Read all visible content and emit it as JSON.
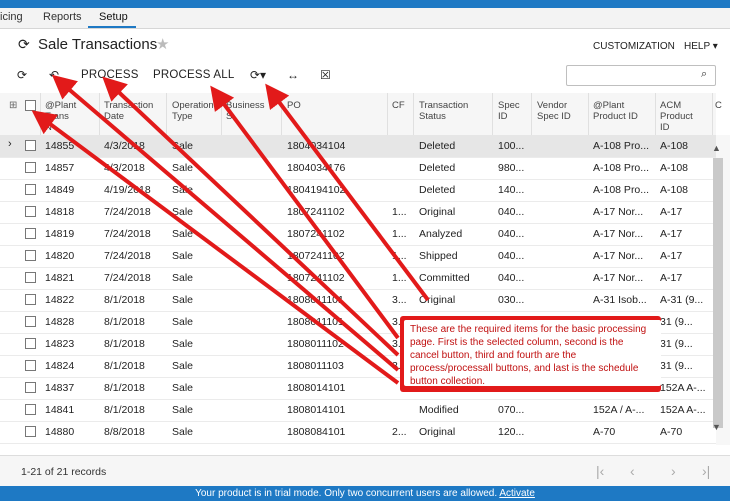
{
  "tabs": [
    {
      "label": "icing"
    },
    {
      "label": "Reports"
    },
    {
      "label": "Setup"
    }
  ],
  "page": {
    "title": "Sale Transactions"
  },
  "header": {
    "customization": "CUSTOMIZATION",
    "help": "HELP"
  },
  "toolbar": {
    "process": "PROCESS",
    "process_all": "PROCESS ALL",
    "refresh_icon": "refresh-icon",
    "undo_icon": "undo-icon",
    "schedule_icon": "schedule-icon",
    "fit_icon": "fit-columns-icon",
    "export_icon": "export-excel-icon"
  },
  "search": {
    "placeholder": ""
  },
  "grid": {
    "columns": [
      "@Plant\nTrans\nN",
      "Transaction\nDate",
      "Operation\nType",
      "Business\nS",
      "PO",
      "CF",
      "Transaction\nStatus",
      "Spec\nID",
      "Vendor\nSpec ID",
      "@Plant\nProduct ID",
      "ACM\nProduct\nID",
      "C"
    ],
    "rows": [
      [
        "14855",
        "4/3/2018",
        "Sale",
        "",
        "1804034104",
        "",
        "Deleted",
        "100...",
        "",
        "A-108 Pro...",
        "A-108"
      ],
      [
        "14857",
        "4/3/2018",
        "Sale",
        "",
        "1804034176",
        "",
        "Deleted",
        "980...",
        "",
        "A-108 Pro...",
        "A-108"
      ],
      [
        "14849",
        "4/19/2018",
        "Sale",
        "",
        "1804194102",
        "",
        "Deleted",
        "140...",
        "",
        "A-108 Pro...",
        "A-108"
      ],
      [
        "14818",
        "7/24/2018",
        "Sale",
        "",
        "1807241102",
        "1...",
        "Original",
        "040...",
        "",
        "A-17 Nor...",
        "A-17"
      ],
      [
        "14819",
        "7/24/2018",
        "Sale",
        "",
        "1807241102",
        "1...",
        "Analyzed",
        "040...",
        "",
        "A-17 Nor...",
        "A-17"
      ],
      [
        "14820",
        "7/24/2018",
        "Sale",
        "",
        "1807241102",
        "1...",
        "Shipped",
        "040...",
        "",
        "A-17 Nor...",
        "A-17"
      ],
      [
        "14821",
        "7/24/2018",
        "Sale",
        "",
        "1807241102",
        "1...",
        "Committed",
        "040...",
        "",
        "A-17 Nor...",
        "A-17"
      ],
      [
        "14822",
        "8/1/2018",
        "Sale",
        "",
        "1808011101",
        "3...",
        "Original",
        "030...",
        "",
        "A-31 Isob...",
        "A-31 (9..."
      ],
      [
        "14828",
        "8/1/2018",
        "Sale",
        "",
        "1808011101",
        "3...",
        "",
        "",
        "",
        "",
        "31 (9..."
      ],
      [
        "14823",
        "8/1/2018",
        "Sale",
        "",
        "1808011102",
        "3...",
        "",
        "",
        "",
        "",
        "31 (9..."
      ],
      [
        "14824",
        "8/1/2018",
        "Sale",
        "",
        "1808011103",
        "3...",
        "",
        "",
        "",
        "",
        "31 (9..."
      ],
      [
        "14837",
        "8/1/2018",
        "Sale",
        "",
        "1808014101",
        "",
        "",
        "",
        "",
        "",
        "152A A-..."
      ],
      [
        "14841",
        "8/1/2018",
        "Sale",
        "",
        "1808014101",
        "",
        "Modified",
        "070...",
        "",
        "152A / A-...",
        "152A A-..."
      ],
      [
        "14880",
        "8/8/2018",
        "Sale",
        "",
        "1808084101",
        "2...",
        "Original",
        "120...",
        "",
        "A-70",
        "A-70"
      ]
    ]
  },
  "footer": {
    "records": "1-21 of 21 records"
  },
  "trial": {
    "text": "Your product is in trial mode. Only two concurrent users are allowed.",
    "link": "Activate"
  },
  "callout": {
    "text": "These are the required items for the basic processing page. First is the selected column, second is the cancel button, third and fourth are the process/processall buttons, and last is the schedule button collection."
  },
  "colors": {
    "brand": "#1e79c4",
    "annotation": "#e21a1a"
  }
}
